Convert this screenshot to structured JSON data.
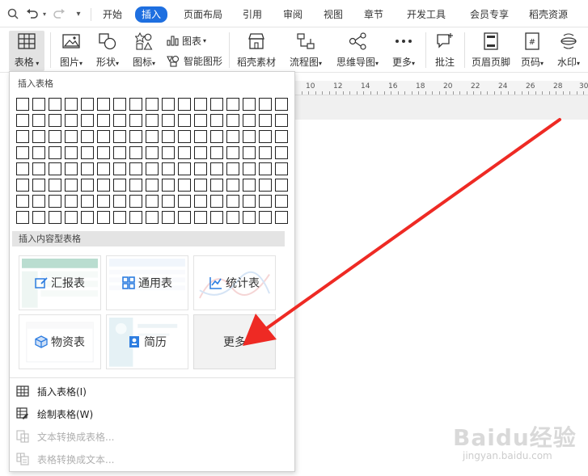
{
  "tabs": [
    "开始",
    "插入",
    "页面布局",
    "引用",
    "审阅",
    "视图",
    "章节",
    "开发工具",
    "会员专享",
    "稻壳资源"
  ],
  "active_tab": "插入",
  "ribbon": {
    "table": "表格",
    "picture": "图片",
    "shape": "形状",
    "icon": "图标",
    "chart": "图表",
    "smart_shape": "智能图形",
    "docer_material": "稻壳素材",
    "flowchart": "流程图",
    "mindmap": "思维导图",
    "more": "更多",
    "comment": "批注",
    "header_footer": "页眉页脚",
    "page_number": "页码",
    "watermark": "水印"
  },
  "ruler": [
    "10",
    "12",
    "14",
    "16",
    "18",
    "20",
    "22",
    "24",
    "26",
    "28",
    "30"
  ],
  "dropdown": {
    "insert_table_title": "插入表格",
    "content_table_title": "插入内容型表格",
    "cards": [
      "汇报表",
      "通用表",
      "统计表",
      "物资表",
      "简历",
      "更多"
    ],
    "menu": {
      "insert_table": "插入表格(I)",
      "draw_table": "绘制表格(W)",
      "text_to_table": "文本转换成表格...",
      "table_to_text": "表格转换成文本..."
    }
  },
  "watermark": {
    "brand": "Baidu经验",
    "url": "jingyan.baidu.com"
  },
  "colors": {
    "accent": "#1e6fe0",
    "arrow": "#ee2a24",
    "card_icon": "#2d7de0"
  }
}
